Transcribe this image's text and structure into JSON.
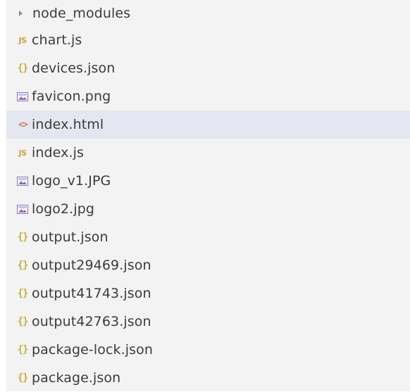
{
  "explorer": {
    "items": [
      {
        "label": "node_modules",
        "type": "folder",
        "icon": "chevron-right-icon",
        "selected": false
      },
      {
        "label": "chart.js",
        "type": "js",
        "icon": "javascript-file-icon",
        "selected": false
      },
      {
        "label": "devices.json",
        "type": "json",
        "icon": "json-file-icon",
        "selected": false
      },
      {
        "label": "favicon.png",
        "type": "image",
        "icon": "image-file-icon",
        "selected": false
      },
      {
        "label": "index.html",
        "type": "html",
        "icon": "html-file-icon",
        "selected": true
      },
      {
        "label": "index.js",
        "type": "js",
        "icon": "javascript-file-icon",
        "selected": false
      },
      {
        "label": "logo_v1.JPG",
        "type": "image",
        "icon": "image-file-icon",
        "selected": false
      },
      {
        "label": "logo2.jpg",
        "type": "image",
        "icon": "image-file-icon",
        "selected": false
      },
      {
        "label": "output.json",
        "type": "json",
        "icon": "json-file-icon",
        "selected": false
      },
      {
        "label": "output29469.json",
        "type": "json",
        "icon": "json-file-icon",
        "selected": false
      },
      {
        "label": "output41743.json",
        "type": "json",
        "icon": "json-file-icon",
        "selected": false
      },
      {
        "label": "output42763.json",
        "type": "json",
        "icon": "json-file-icon",
        "selected": false
      },
      {
        "label": "package-lock.json",
        "type": "json",
        "icon": "json-file-icon",
        "selected": false
      },
      {
        "label": "package.json",
        "type": "json",
        "icon": "json-file-icon",
        "selected": false
      }
    ],
    "icon_glyphs": {
      "js": "JS",
      "json": "{}",
      "html": "<>"
    }
  },
  "colors": {
    "panel_background": "#f3f3f3",
    "selected_row": "#e4e6f1",
    "text": "#3b3b3b",
    "js_icon": "#c8a23a",
    "json_icon": "#c5b13b",
    "html_icon": "#e27b4e",
    "image_icon": "#8b6fb8"
  }
}
